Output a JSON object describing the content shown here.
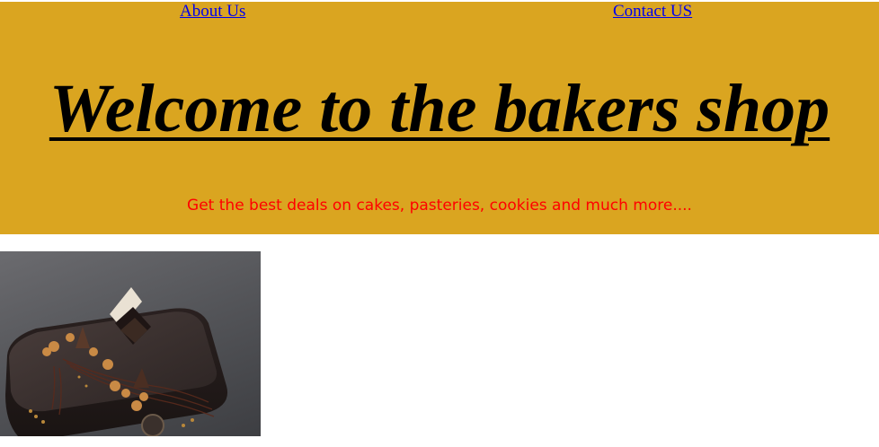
{
  "nav": {
    "about_label": "About Us",
    "contact_label": "Contact US"
  },
  "hero": {
    "title": "Welcome to the bakers shop",
    "tagline": "Get the best deals on cakes, pasteries, cookies and much more....",
    "background_color": "#DAA520",
    "title_color": "#000000",
    "tagline_color": "#FF0000",
    "link_color": "#0000EE"
  },
  "product_image": {
    "icon": "chocolate-cake-photo"
  }
}
